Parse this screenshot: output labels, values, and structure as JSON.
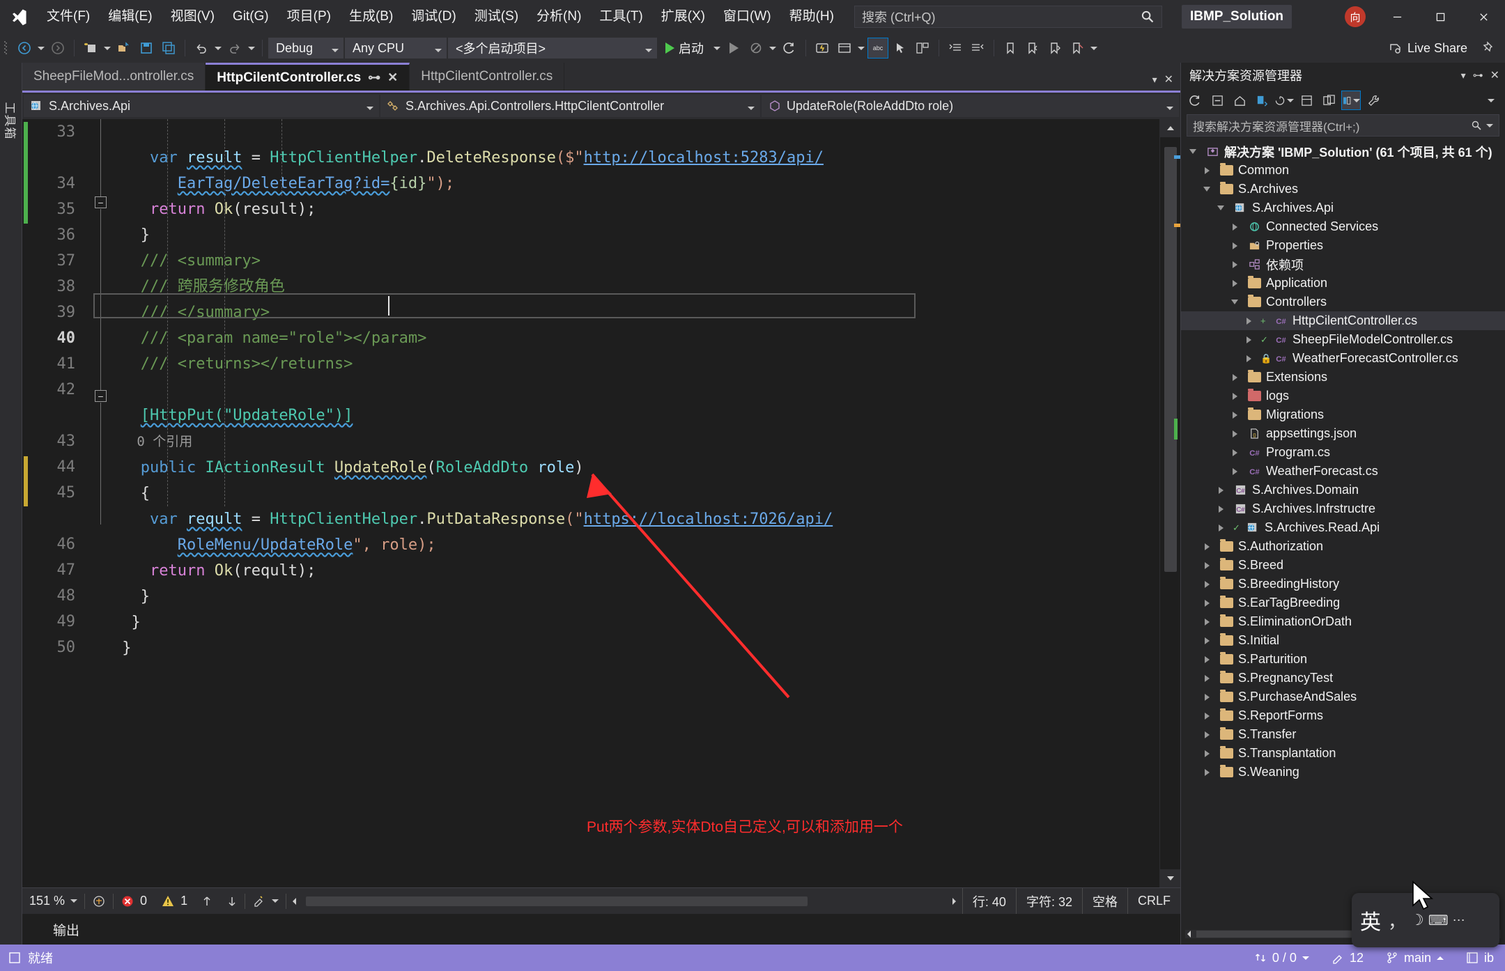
{
  "titlebar": {
    "logo_icon": "visual-studio-logo",
    "menus": [
      "文件(F)",
      "编辑(E)",
      "视图(V)",
      "Git(G)",
      "项目(P)",
      "生成(B)",
      "调试(D)",
      "测试(S)",
      "分析(N)",
      "工具(T)",
      "扩展(X)",
      "窗口(W)",
      "帮助(H)"
    ],
    "search_placeholder": "搜索 (Ctrl+Q)",
    "search_icon": "search-icon",
    "solution_name": "IBMP_Solution",
    "avatar_initial": "向",
    "minimize_icon": "minimize-icon",
    "maximize_icon": "maximize-icon",
    "close_icon": "close-icon"
  },
  "toolbar": {
    "back_icon": "navigate-back-icon",
    "forward_icon": "navigate-forward-icon",
    "new_project_icon": "new-project-icon",
    "open_file_icon": "open-file-icon",
    "save_icon": "save-icon",
    "save_all_icon": "save-all-icon",
    "undo_icon": "undo-icon",
    "redo_icon": "redo-icon",
    "configuration": "Debug",
    "platform": "Any CPU",
    "startup_project": "<多个启动项目>",
    "run_label": "启动",
    "run_icon": "play-icon",
    "attach_icon": "play-outline-icon",
    "stop_icon": "stop-icon",
    "restart_icon": "restart-icon",
    "live_share": "Live Share",
    "live_share_icon": "live-share-icon",
    "pin_icon": "pin-icon"
  },
  "left_rail": {
    "label": "工具箱"
  },
  "editor": {
    "tabs": [
      {
        "label": "SheepFileMod...ontroller.cs",
        "state": "inactive"
      },
      {
        "label": "HttpCilentController.cs",
        "state": "active",
        "pin_icon": "pin-icon",
        "close_icon": "close-icon"
      },
      {
        "label": "HttpCilentController.cs",
        "state": "inactive"
      }
    ],
    "navbar": {
      "project": "S.Archives.Api",
      "project_icon": "project-web-icon",
      "type": "S.Archives.Api.Controllers.HttpCilentController",
      "type_icon": "class-icon",
      "member": "UpdateRole(RoleAddDto role)",
      "member_icon": "method-icon"
    },
    "first_line_number": 33,
    "lines": [
      {
        "n": 33,
        "change": "green"
      },
      {
        "n": 34
      },
      {
        "n": 35
      },
      {
        "n": 36,
        "fold": true
      },
      {
        "n": 37
      },
      {
        "n": 38
      },
      {
        "n": 39
      },
      {
        "n": 40,
        "current": true
      },
      {
        "n": 41
      },
      {
        "n": 42
      },
      {
        "n": 43,
        "fold": true
      },
      {
        "n": 44
      },
      {
        "n": 45,
        "change": "yellow"
      },
      {
        "n": 46
      },
      {
        "n": 47
      },
      {
        "n": 48
      },
      {
        "n": 49
      },
      {
        "n": 50
      }
    ],
    "code": {
      "l33a_var": "var",
      "l33a_name": "result",
      "l33a_eq": " = ",
      "l33a_cls": "HttpClientHelper",
      "l33a_dot": ".",
      "l33a_mth": "DeleteResponse",
      "l33a_open": "($\"",
      "l33a_url": "http://localhost:5283/api/",
      "l33b_url": "EarTag/DeleteEarTag?id=",
      "l33b_interp": "{id}",
      "l33b_end": "\");",
      "l34_ret": "return",
      "l34_ok": "Ok",
      "l34_rest": "(result);",
      "l35": "}",
      "l36": "/// <summary>",
      "l37": "/// 跨服务修改角色",
      "l38": "/// </summary>",
      "l39": "/// <param name=\"role\"></param>",
      "l40": "/// <returns></returns>",
      "l42_attr": "[HttpPut(\"UpdateRole\")]",
      "l42_refs": "0 个引用",
      "l43_pub": "public",
      "l43_ret": "IActionResult",
      "l43_name": "UpdateRole",
      "l43_ptype": "RoleAddDto",
      "l43_pname": "role",
      "l44": "{",
      "l45a_var": "var",
      "l45a_name": "reqult",
      "l45a_cls": "HttpClientHelper",
      "l45a_mth": "PutDataResponse",
      "l45a_open": "(\"",
      "l45a_url": "https://localhost:7026/api/",
      "l45b_url": "RoleMenu/UpdateRole",
      "l45b_end": "\", role);",
      "l46_ret": "return",
      "l46_ok": "Ok",
      "l46_rest": "(reqult);",
      "l47": "}",
      "l48": "}",
      "l49": "}"
    },
    "annotation": {
      "text": "Put两个参数,实体Dto自己定义,可以和添加用一个",
      "color": "#ff2d2d"
    }
  },
  "editor_status": {
    "zoom": "151 %",
    "zoom_caret_icon": "chevron-down-icon",
    "ime_icon": "ime-icon",
    "error_icon": "error-icon",
    "error_count": "0",
    "warning_icon": "warning-icon",
    "warning_count": "1",
    "up_icon": "arrow-up-icon",
    "down_icon": "arrow-down-icon",
    "broom_icon": "code-cleanup-icon",
    "line_label": "行: 40",
    "char_label": "字符: 32",
    "spaces_label": "空格",
    "eol_label": "CRLF"
  },
  "output_panel": {
    "title": "输出"
  },
  "solution_explorer": {
    "title": "解决方案资源管理器",
    "toggle_icon": "chevron-down-icon",
    "pin_icon": "pin-icon",
    "close_icon": "close-icon",
    "toolbar_icons": [
      "refresh-icon",
      "home-icon",
      "sync-with-active-document-icon",
      "collapse-all-icon",
      "properties-icon",
      "show-all-files-icon",
      "preview-selected-items-icon",
      "view-switch-icon",
      "wrench-icon"
    ],
    "search_placeholder": "搜索解决方案资源管理器(Ctrl+;)",
    "search_icon": "search-icon",
    "filter_icon": "chevron-down-icon",
    "root": "解决方案 'IBMP_Solution' (61 个项目, 共 61 个)",
    "tree": [
      {
        "depth": 1,
        "label": "Common",
        "icon": "folder",
        "chev": "closed"
      },
      {
        "depth": 1,
        "label": "S.Archives",
        "icon": "folder",
        "chev": "open"
      },
      {
        "depth": 2,
        "label": "S.Archives.Api",
        "icon": "project-web",
        "chev": "open"
      },
      {
        "depth": 3,
        "label": "Connected Services",
        "icon": "connected-services",
        "chev": "closed"
      },
      {
        "depth": 3,
        "label": "Properties",
        "icon": "properties",
        "chev": "closed"
      },
      {
        "depth": 3,
        "label": "依赖项",
        "icon": "dependencies",
        "chev": "closed"
      },
      {
        "depth": 3,
        "label": "Application",
        "icon": "folder",
        "chev": "closed"
      },
      {
        "depth": 3,
        "label": "Controllers",
        "icon": "folder",
        "chev": "open"
      },
      {
        "depth": 4,
        "label": "HttpCilentController.cs",
        "icon": "cs-file",
        "chev": "closed",
        "selected": true,
        "status": "add"
      },
      {
        "depth": 4,
        "label": "SheepFileModelController.cs",
        "icon": "cs-file",
        "chev": "closed",
        "status": "check"
      },
      {
        "depth": 4,
        "label": "WeatherForecastController.cs",
        "icon": "cs-file",
        "chev": "closed",
        "status": "lock"
      },
      {
        "depth": 3,
        "label": "Extensions",
        "icon": "folder",
        "chev": "closed"
      },
      {
        "depth": 3,
        "label": "logs",
        "icon": "folder-red",
        "chev": "closed"
      },
      {
        "depth": 3,
        "label": "Migrations",
        "icon": "folder",
        "chev": "closed"
      },
      {
        "depth": 3,
        "label": "appsettings.json",
        "icon": "json-file",
        "chev": "closed"
      },
      {
        "depth": 3,
        "label": "Program.cs",
        "icon": "cs-file",
        "chev": "closed"
      },
      {
        "depth": 3,
        "label": "WeatherForecast.cs",
        "icon": "cs-file",
        "chev": "closed"
      },
      {
        "depth": 2,
        "label": "S.Archives.Domain",
        "icon": "project-lib",
        "chev": "closed"
      },
      {
        "depth": 2,
        "label": "S.Archives.Infrstructre",
        "icon": "project-lib",
        "chev": "closed"
      },
      {
        "depth": 2,
        "label": "S.Archives.Read.Api",
        "icon": "project-web",
        "chev": "closed",
        "status": "check"
      },
      {
        "depth": 1,
        "label": "S.Authorization",
        "icon": "folder",
        "chev": "closed"
      },
      {
        "depth": 1,
        "label": "S.Breed",
        "icon": "folder",
        "chev": "closed"
      },
      {
        "depth": 1,
        "label": "S.BreedingHistory",
        "icon": "folder",
        "chev": "closed"
      },
      {
        "depth": 1,
        "label": "S.EarTagBreeding",
        "icon": "folder",
        "chev": "closed"
      },
      {
        "depth": 1,
        "label": "S.EliminationOrDath",
        "icon": "folder",
        "chev": "closed"
      },
      {
        "depth": 1,
        "label": "S.Initial",
        "icon": "folder",
        "chev": "closed"
      },
      {
        "depth": 1,
        "label": "S.Parturition",
        "icon": "folder",
        "chev": "closed"
      },
      {
        "depth": 1,
        "label": "S.PregnancyTest",
        "icon": "folder",
        "chev": "closed"
      },
      {
        "depth": 1,
        "label": "S.PurchaseAndSales",
        "icon": "folder",
        "chev": "closed"
      },
      {
        "depth": 1,
        "label": "S.ReportForms",
        "icon": "folder",
        "chev": "closed"
      },
      {
        "depth": 1,
        "label": "S.Transfer",
        "icon": "folder",
        "chev": "closed"
      },
      {
        "depth": 1,
        "label": "S.Transplantation",
        "icon": "folder",
        "chev": "closed"
      },
      {
        "depth": 1,
        "label": "S.Weaning",
        "icon": "folder",
        "chev": "closed"
      }
    ]
  },
  "statusbar": {
    "ready": "就绪",
    "ready_icon": "ready-icon",
    "changes": "0 / 0",
    "changes_icon": "source-control-updown-icon",
    "pending": "12",
    "pending_icon": "pencil-icon",
    "branch": "main",
    "branch_icon": "branch-icon",
    "branch_caret": "caret-up-icon",
    "repo_icon": "repository-icon",
    "repo": "ib",
    "accent_color": "#8b7fd4"
  },
  "ime_widget": {
    "label": "英",
    "icon": "ime-chinese-icon"
  }
}
